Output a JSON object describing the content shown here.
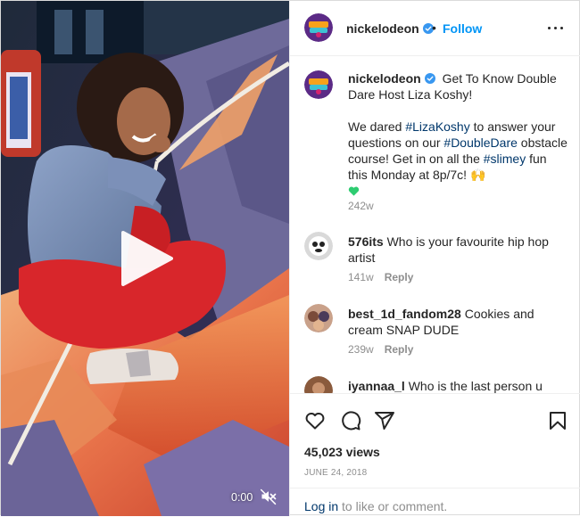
{
  "video": {
    "time": "0:00",
    "icons": {
      "play": "play-icon",
      "mute": "mute-icon"
    }
  },
  "header": {
    "username": "nickelodeon",
    "separator": "•",
    "follow_label": "Follow",
    "icons": {
      "verified": "verified-icon",
      "more": "more-options-icon"
    }
  },
  "caption": {
    "username": "nickelodeon",
    "line1": "Get To Know Double Dare Host Liza Koshy!",
    "p2_a": "We dared ",
    "tag1": "#LizaKoshy",
    "p2_b": " to answer your questions on our ",
    "tag2": "#DoubleDare",
    "p2_c": " obstacle course! Get in on all the ",
    "tag3": "#slimey",
    "p2_d": " fun this Monday at 8p/7c! 🙌",
    "time": "242w"
  },
  "comments": [
    {
      "username": "576its",
      "text": "Who is your favourite hip hop artist",
      "time": "141w",
      "reply_label": "Reply"
    },
    {
      "username": "best_1d_fandom28",
      "text": "Cookies and cream SNAP DUDE",
      "time": "239w",
      "reply_label": "Reply"
    },
    {
      "username": "iyannaa_l",
      "text": "Who is the last person u dated"
    }
  ],
  "actions": {
    "icons": [
      "heart-icon",
      "comment-icon",
      "share-icon",
      "bookmark-icon"
    ],
    "views": "45,023 views",
    "date": "JUNE 24, 2018"
  },
  "login": {
    "link": "Log in",
    "rest": " to like or comment."
  },
  "colors": {
    "link_blue": "#0095f6",
    "hashtag": "#00376b",
    "secondary_text": "#8e8e8e",
    "verified_blue": "#3897f0",
    "heart_green": "#2ecc71"
  }
}
